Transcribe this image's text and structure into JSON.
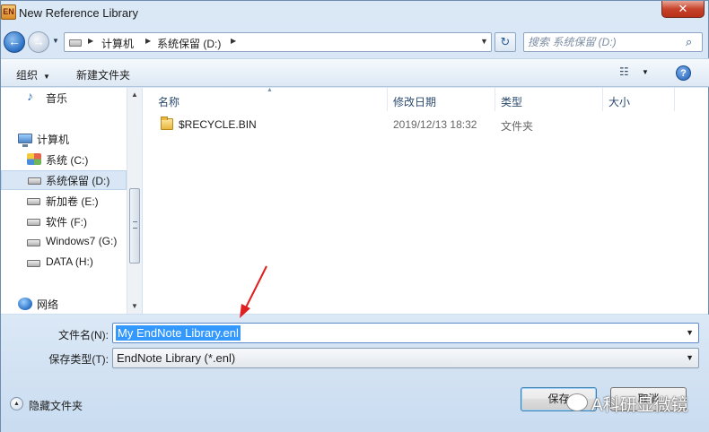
{
  "window": {
    "title": "New Reference Library",
    "app_icon_text": "EN",
    "close_glyph": "✕"
  },
  "address_bar": {
    "segments": [
      "计算机",
      "系统保留 (D:)"
    ]
  },
  "search": {
    "placeholder": "搜索 系统保留 (D:)"
  },
  "toolbar": {
    "organize_label": "组织",
    "new_folder_label": "新建文件夹",
    "help_glyph": "?"
  },
  "sidebar": {
    "items": [
      {
        "label": "音乐",
        "icon": "music-icon"
      },
      {
        "label": "计算机",
        "icon": "computer-icon"
      },
      {
        "label": "系统 (C:)",
        "icon": "windows-drive-icon"
      },
      {
        "label": "系统保留 (D:)",
        "icon": "drive-icon",
        "selected": true
      },
      {
        "label": "新加卷 (E:)",
        "icon": "drive-icon"
      },
      {
        "label": "软件 (F:)",
        "icon": "drive-icon"
      },
      {
        "label": "Windows7 (G:)",
        "icon": "drive-icon"
      },
      {
        "label": "DATA (H:)",
        "icon": "drive-icon"
      },
      {
        "label": "网络",
        "icon": "network-icon"
      }
    ]
  },
  "file_list": {
    "columns": [
      "名称",
      "修改日期",
      "类型",
      "大小"
    ],
    "rows": [
      {
        "name": "$RECYCLE.BIN",
        "modified": "2019/12/13 18:32",
        "type": "文件夹",
        "size": ""
      }
    ]
  },
  "form": {
    "filename_label": "文件名(N):",
    "filename_value": "My EndNote Library.enl",
    "filetype_label": "保存类型(T):",
    "filetype_value": "EndNote Library (*.enl)",
    "hide_folders_label": "隐藏文件夹",
    "save_label": "保存",
    "cancel_label": "取消"
  },
  "watermark": {
    "text": "A科研显微镜"
  },
  "colors": {
    "selection": "#3399ff",
    "annotation_arrow": "#e02020",
    "window_bg": "#cfdff0"
  }
}
